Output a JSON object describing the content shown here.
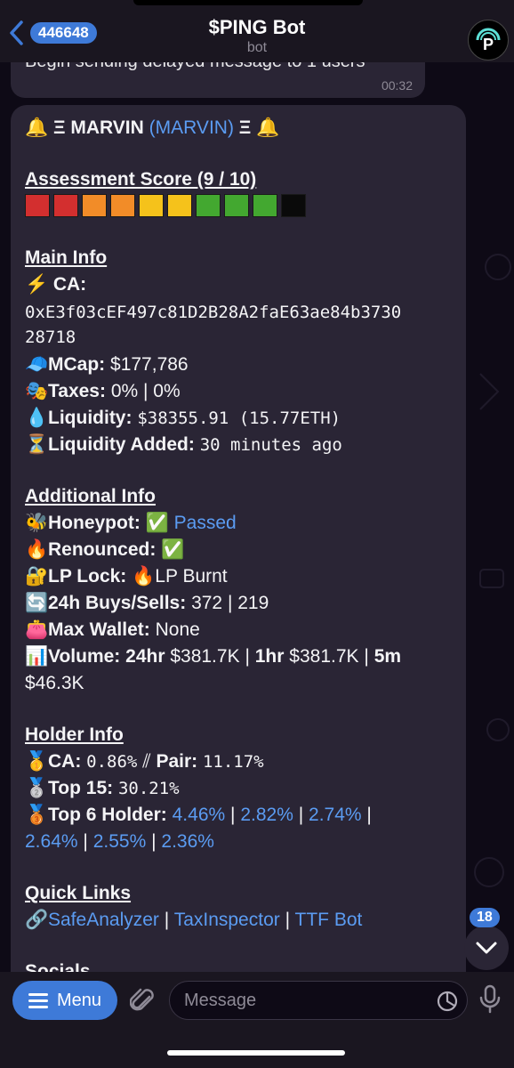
{
  "header": {
    "back_count": "446648",
    "title": "$PING Bot",
    "subtitle": "bot"
  },
  "prev_message": {
    "text": "Begin sending delayed message to 1 users",
    "time": "00:32"
  },
  "message": {
    "token_title": {
      "bell": "🔔",
      "left_xi": "Ξ",
      "name": "MARVIN",
      "ticker": "(MARVIN)",
      "right_xi": "Ξ"
    },
    "assessment": {
      "heading": "Assessment Score (9 / 10)",
      "bar_colors": [
        "#d32f2f",
        "#d32f2f",
        "#f28c28",
        "#f28c28",
        "#f5c21b",
        "#f5c21b",
        "#43a830",
        "#43a830",
        "#43a830",
        "#0a0a0a"
      ]
    },
    "main_info": {
      "heading": "Main Info",
      "ca_icon": "⚡",
      "ca_label": "CA:",
      "ca_line1": "0xE3f03cEF497c81D2B28A2faE63ae84b3730",
      "ca_line2": "28718",
      "mcap_icon": "🧢",
      "mcap_label": "MCap:",
      "mcap_value": "$177,786",
      "taxes_icon": "🎭",
      "taxes_label": "Taxes:",
      "taxes_value": "0% | 0%",
      "liq_icon": "💧",
      "liq_label": "Liquidity:",
      "liq_value": "$38355.91 (15.77ETH)",
      "added_icon": "⏳",
      "added_label": "Liquidity Added:",
      "added_value": "30 minutes ago"
    },
    "additional_info": {
      "heading": "Additional Info",
      "honeypot_icon": "🐝",
      "honeypot_label": "Honeypot:",
      "honeypot_check": "✅",
      "honeypot_link": "Passed",
      "renounced_icon": "🔥",
      "renounced_label": "Renounced:",
      "renounced_check": "✅",
      "lp_icon": "🔐",
      "lp_label": "LP Lock:",
      "lp_fire": "🔥",
      "lp_value": "LP Burnt",
      "buys_icon": "🔄",
      "buys_label": "24h Buys/Sells:",
      "buys_value": "372 | 219",
      "wallet_icon": "👛",
      "wallet_label": "Max Wallet:",
      "wallet_value": "None",
      "volume_icon": "📊",
      "volume_label": "Volume:",
      "vol_24_label": "24hr",
      "vol_24_value": "$381.7K",
      "vol_sep1": "|",
      "vol_1h_label": "1hr",
      "vol_1h_value": "$381.7K",
      "vol_sep2": "|",
      "vol_5m_label": "5m",
      "vol_5m_value": "$46.3K"
    },
    "holder_info": {
      "heading": "Holder Info",
      "ca_icon": "🥇",
      "ca_label": "CA:",
      "ca_value": "0.86%",
      "pair_sep": "⫽",
      "pair_label": "Pair:",
      "pair_value": "11.17%",
      "top15_icon": "🥈",
      "top15_label": "Top 15:",
      "top15_value": "30.21%",
      "top6_icon": "🥉",
      "top6_label": "Top 6 Holder:",
      "top6_values": [
        "4.46%",
        "2.82%",
        "2.74%",
        "2.64%",
        "2.55%",
        "2.36%"
      ],
      "sep": "|"
    },
    "quick_links": {
      "heading": "Quick Links",
      "icon": "🔗",
      "links": [
        "SafeAnalyzer",
        "TaxInspector",
        "TTF Bot"
      ],
      "sep": "|"
    },
    "socials_heading": "Socials"
  },
  "scroll": {
    "unread_count": "18"
  },
  "bottom_bar": {
    "menu_label": "Menu",
    "input_placeholder": "Message"
  },
  "colors": {
    "accent": "#3e7ad8",
    "link": "#5b9cf2",
    "bubble": "#2a2535"
  }
}
